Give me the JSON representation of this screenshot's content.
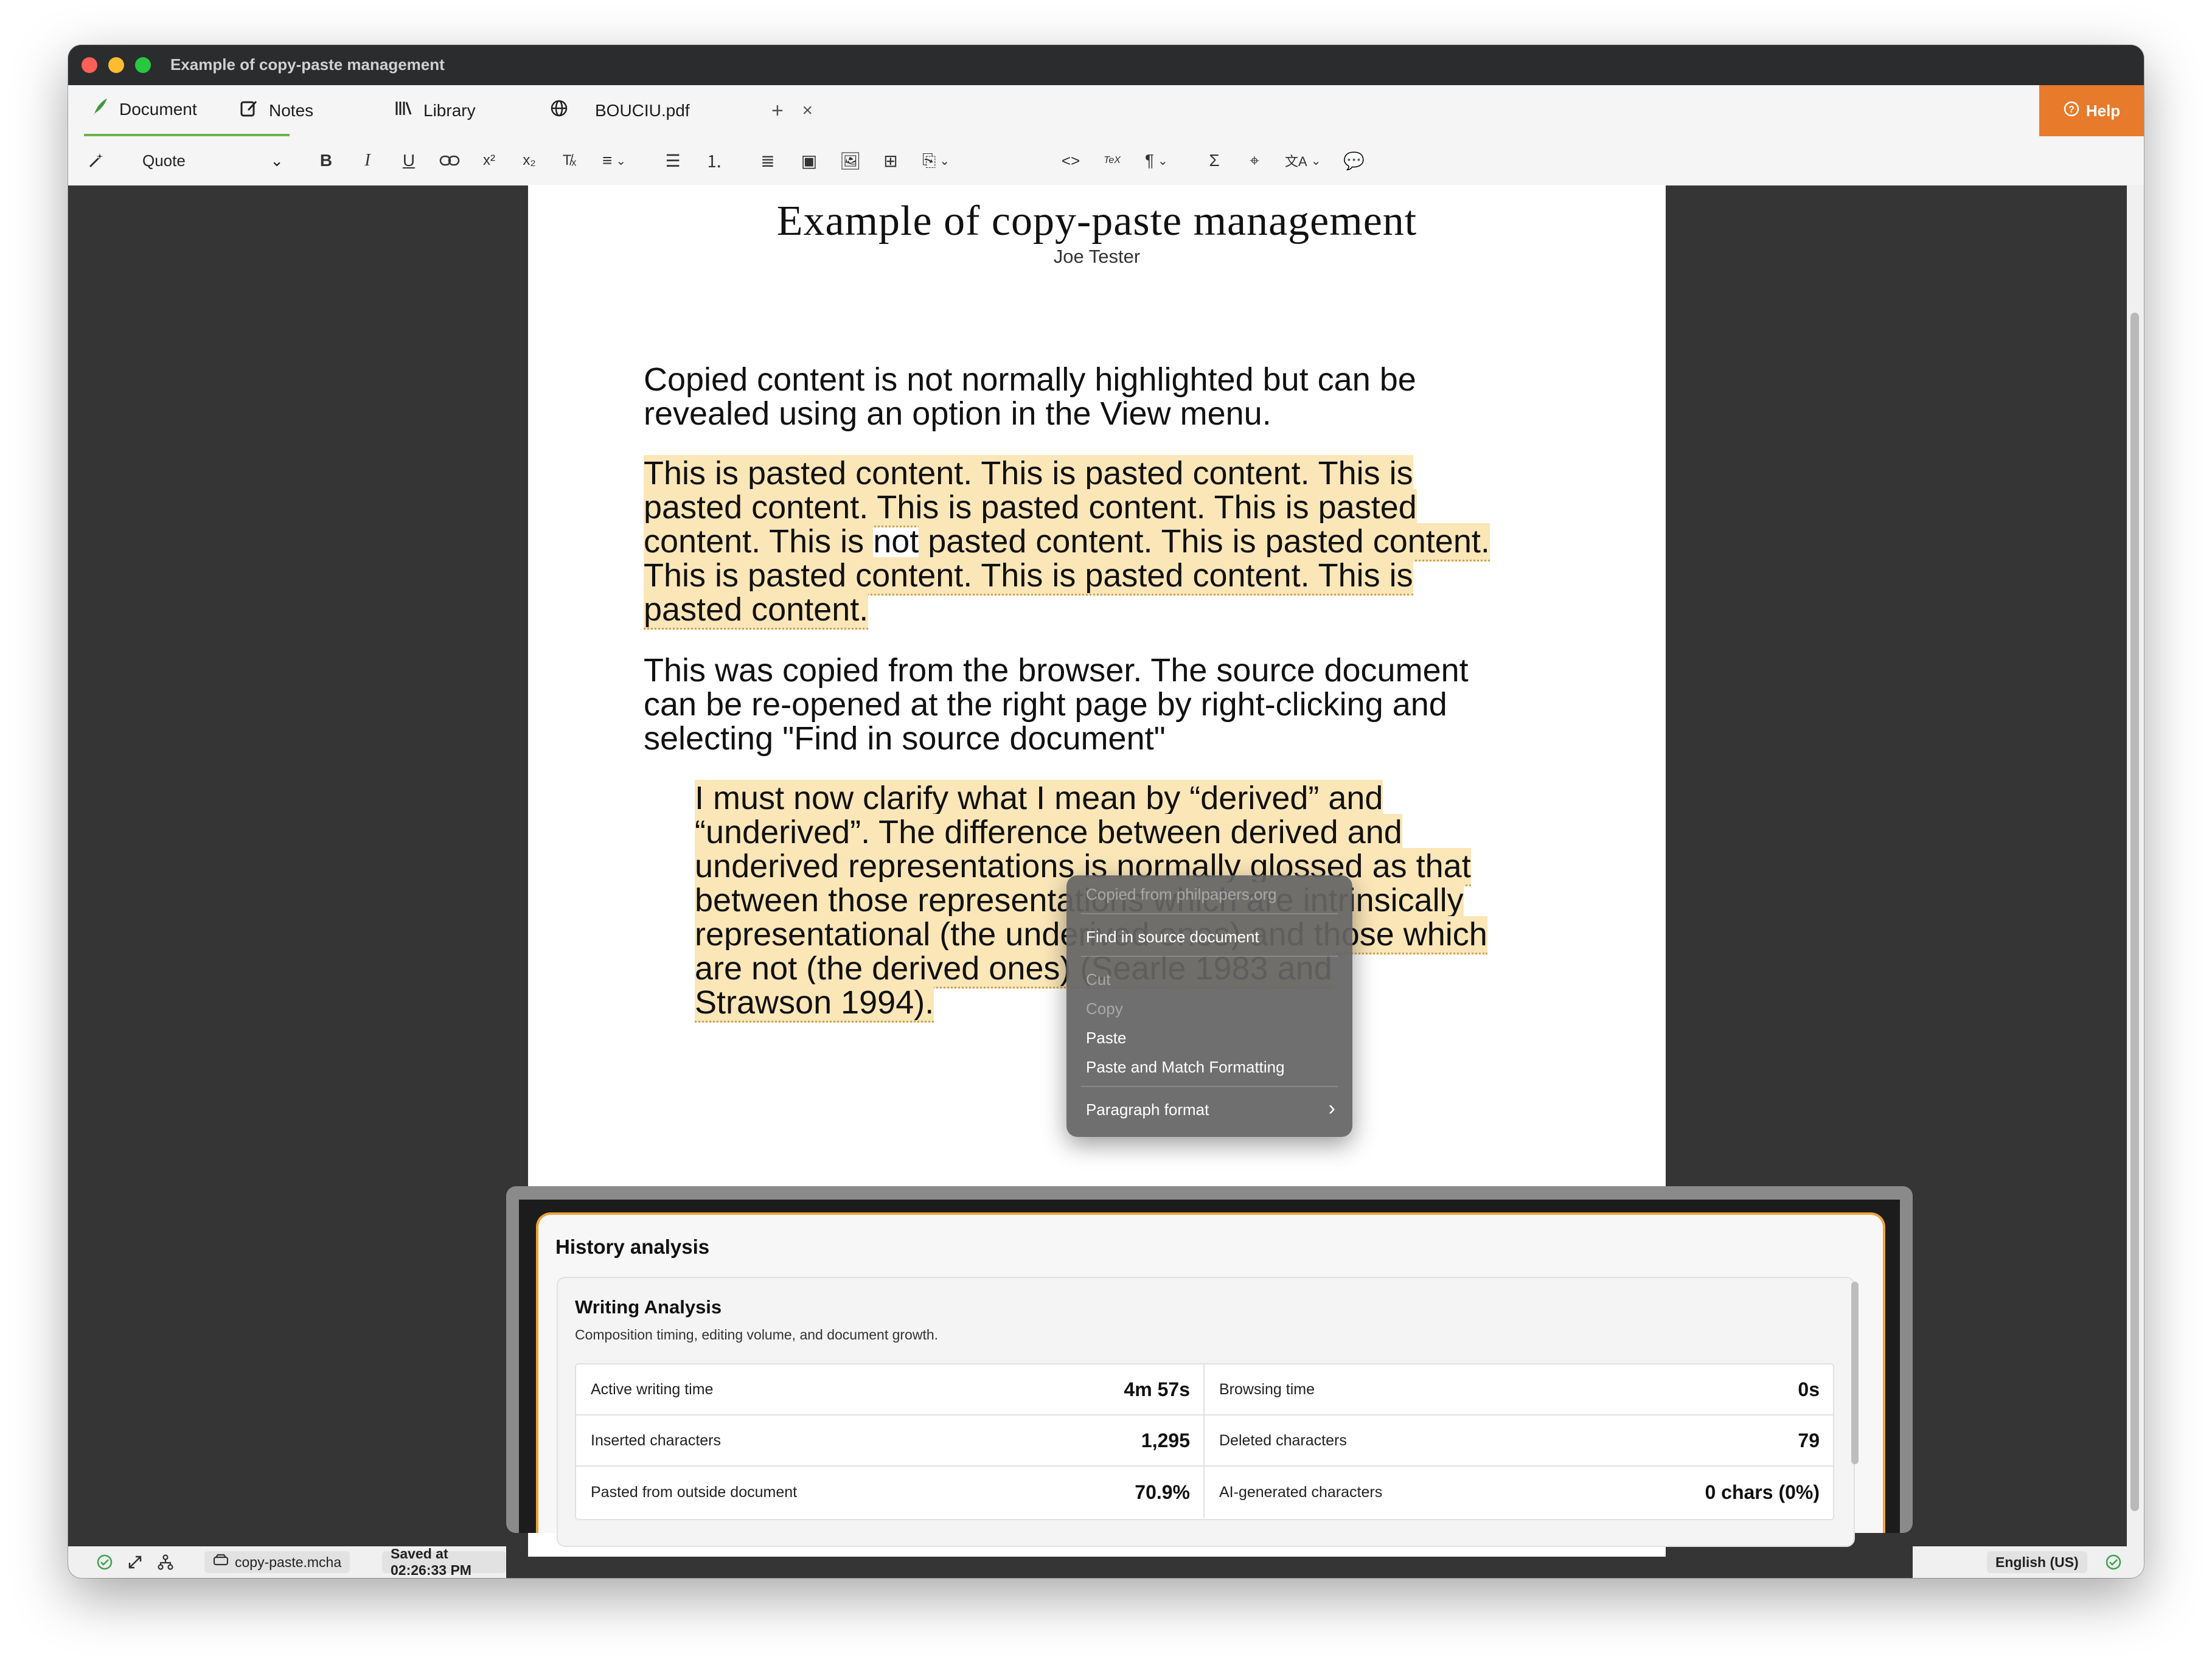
{
  "window": {
    "title": "Example of copy-paste management"
  },
  "tabs": [
    {
      "label": "Document",
      "icon": "feather-icon"
    },
    {
      "label": "Notes",
      "icon": "notes-icon"
    },
    {
      "label": "Library",
      "icon": "library-icon"
    },
    {
      "label": "BOUCIU.pdf",
      "icon": "globe-icon"
    }
  ],
  "new_tab": "+",
  "close_tab": "×",
  "help": {
    "label": "Help"
  },
  "toolbar": {
    "paragraph_style": "Quote",
    "glyphs": {
      "bold": "B",
      "italic": "I",
      "underline": "U",
      "link": "🔗",
      "superscript": "x²",
      "subscript": "x₂",
      "clear": "T̸ₓ",
      "align": "≡",
      "bullet": "☰",
      "numbered": "⒈",
      "justify": "≣",
      "save": "▣",
      "image": "🖼",
      "table": "⊞",
      "insert": "⎘",
      "code": "<>",
      "tex": "TeX",
      "pilcrow": "¶",
      "sigma": "Σ",
      "tag": "⌖",
      "translate": "文A",
      "comment": "💬",
      "chevron": "⌄"
    }
  },
  "document": {
    "title": "Example of copy-paste management",
    "author": "Joe Tester",
    "para1_lines": [
      "Copied content is not normally highlighted but can be",
      "revealed using an option in the View menu."
    ],
    "para2_lines": [
      "This is pasted content. This is pasted content. This is",
      "pasted content. This is pasted content. This is pasted",
      "content. This is ",
      "not",
      " pasted content. This is pasted content.",
      "This is pasted content. This is pasted content. This is",
      "pasted content."
    ],
    "para3_lines": [
      "This was copied from the browser. The source document",
      "can be re-opened at the right page by right-clicking and",
      "selecting \"Find in source document\""
    ],
    "quote_lines": [
      "I must now clarify what I mean by “derived” and",
      "“underived”. The difference between derived and",
      "underived representations is normally glossed as that",
      "between those representations which are intrinsically",
      "representational (the underived ones) and those which",
      "are not (the derived ones) (Searle 1983 and",
      "Strawson 1994)."
    ]
  },
  "context_menu": {
    "header": "Copied from philpapers.org",
    "find": "Find in source document",
    "cut": "Cut",
    "copy": "Copy",
    "paste": "Paste",
    "paste_match": "Paste and Match Formatting",
    "paragraph_format": "Paragraph format",
    "submenu_arrow": "›"
  },
  "history": {
    "title": "History analysis",
    "card_title": "Writing Analysis",
    "card_subtitle": "Composition timing, editing volume, and document growth.",
    "stats": [
      {
        "label": "Active writing time",
        "value": "4m 57s"
      },
      {
        "label": "Browsing time",
        "value": "0s"
      },
      {
        "label": "Inserted characters",
        "value": "1,295"
      },
      {
        "label": "Deleted characters",
        "value": "79"
      },
      {
        "label": "Pasted from outside document",
        "value": "70.9%"
      },
      {
        "label": "AI-generated characters",
        "value": "0 chars (0%)"
      }
    ]
  },
  "statusbar": {
    "filename": "copy-paste.mcha",
    "saved": "Saved at 02:26:33 PM",
    "language": "English (US)"
  },
  "colors": {
    "accent_green": "#6fb24a",
    "help_orange": "#e77a2b",
    "highlight": "#fbe6b8",
    "panel_border": "#f0a23a"
  }
}
